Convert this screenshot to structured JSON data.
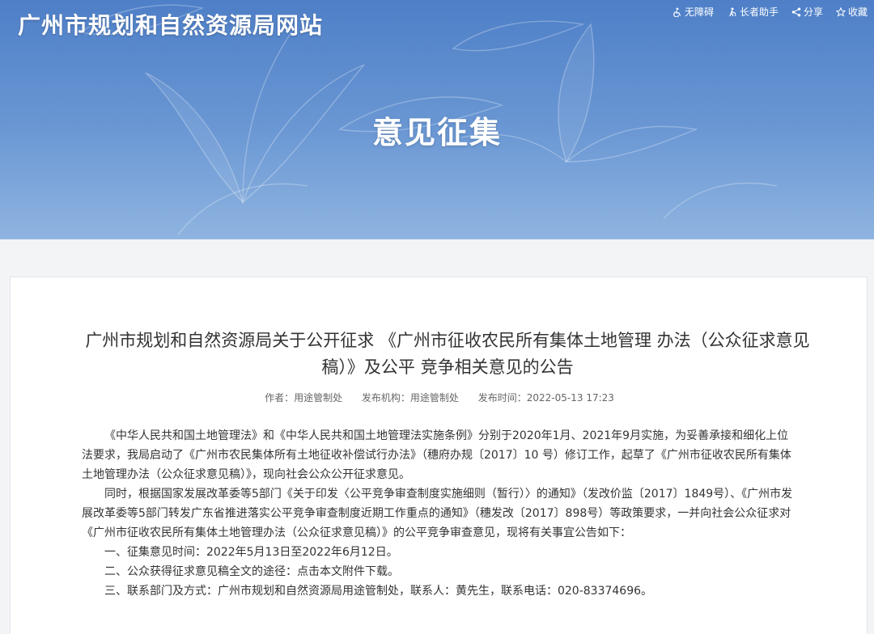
{
  "header": {
    "site_title": "广州市规划和自然资源局网站",
    "tools": [
      {
        "label": "无障碍",
        "icon": "accessibility-icon"
      },
      {
        "label": "长者助手",
        "icon": "elder-helper-icon"
      },
      {
        "label": "分享",
        "icon": "share-icon"
      },
      {
        "label": "收藏",
        "icon": "star-icon"
      }
    ]
  },
  "banner": {
    "section_title": "意见征集"
  },
  "article": {
    "title": "广州市规划和自然资源局关于公开征求 《广州市征收农民所有集体土地管理 办法（公众征求意见稿）》及公平 竞争相关意见的公告",
    "meta": {
      "author": "作者：用途管制处",
      "publisher": "发布机构：用途管制处",
      "time": "发布时间：2022-05-13 17:23"
    },
    "paragraphs": [
      "《中华人民共和国土地管理法》和《中华人民共和国土地管理法实施条例》分别于2020年1月、2021年9月实施，为妥善承接和细化上位法要求，我局启动了《广州市农民集体所有土地征收补偿试行办法》（穗府办规〔2017〕10 号）修订工作，起草了《广州市征收农民所有集体土地管理办法（公众征求意见稿）》，现向社会公众公开征求意见。",
      "同时，根据国家发展改革委等5部门《关于印发〈公平竞争审查制度实施细则（暂行）〉的通知》（发改价监〔2017〕1849号）、《广州市发展改革委等5部门转发广东省推进落实公平竞争审查制度近期工作重点的通知》（穗发改〔2017〕898号）等政策要求，一并向社会公众征求对《广州市征收农民所有集体土地管理办法（公众征求意见稿）》的公平竞争审查意见，现将有关事宜公告如下：",
      "一、征集意见时间：2022年5月13日至2022年6月12日。",
      "二、公众获得征求意见稿全文的途径：点击本文附件下载。",
      "三、联系部门及方式：广州市规划和自然资源局用途管制处，联系人：黄先生，联系电话：020-83374696。"
    ]
  },
  "colors": {
    "banner_top": "#4e7fc7",
    "banner_bottom": "#8fb4e0",
    "page_bg": "#f3f4f6",
    "text": "#333333"
  }
}
